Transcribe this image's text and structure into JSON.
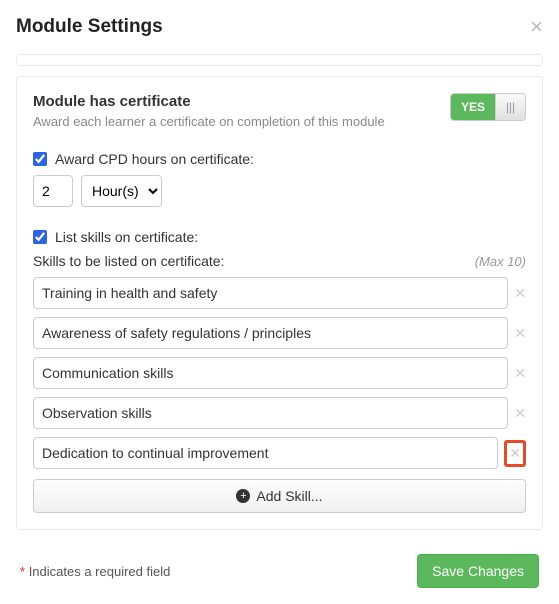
{
  "modal": {
    "title": "Module Settings"
  },
  "certificate": {
    "heading": "Module has certificate",
    "sub": "Award each learner a certificate on completion of this module",
    "toggle_value": "YES"
  },
  "cpd": {
    "checkbox_label": "Award CPD hours on certificate:",
    "checked": true,
    "value": "2",
    "unit_selected": "Hour(s)"
  },
  "skills": {
    "checkbox_label": "List skills on certificate:",
    "checked": true,
    "list_label": "Skills to be listed on certificate:",
    "max_note": "(Max 10)",
    "items": [
      "Training in health and safety",
      "Awareness of safety regulations / principles",
      "Communication skills",
      "Observation skills",
      "Dedication to continual improvement"
    ],
    "add_label": "Add Skill..."
  },
  "footer": {
    "required_note": "Indicates a required field",
    "save_label": "Save Changes"
  }
}
